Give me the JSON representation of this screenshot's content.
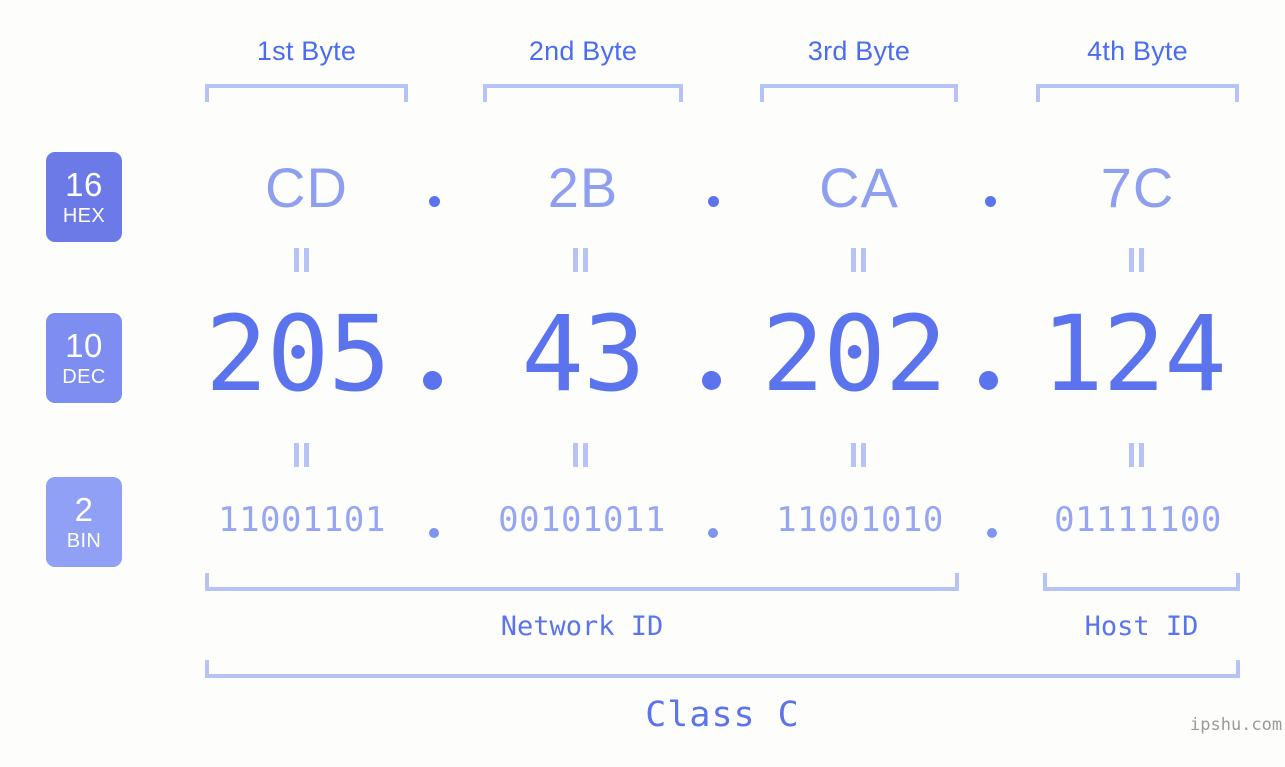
{
  "background_color": "#fdfefb",
  "colors": {
    "label_blue": "#4a6cf0",
    "bracket": "#b7c3f7",
    "hex_text": "#8f9ff0",
    "dec_text": "#5b74ee",
    "bin_text": "#97a6f2",
    "badge_hex": "#6c7ae8",
    "badge_dec": "#7d8df0",
    "badge_bin": "#8fa0f5",
    "watermark": "#9a9a9a"
  },
  "byte_headers": [
    {
      "label": "1st Byte"
    },
    {
      "label": "2nd Byte"
    },
    {
      "label": "3rd Byte"
    },
    {
      "label": "4th Byte"
    }
  ],
  "badges": [
    {
      "radix": "16",
      "name": "HEX"
    },
    {
      "radix": "10",
      "name": "DEC"
    },
    {
      "radix": "2",
      "name": "BIN"
    }
  ],
  "rows": {
    "hex": {
      "values": [
        "CD",
        "2B",
        "CA",
        "7C"
      ],
      "separator": "."
    },
    "dec": {
      "values": [
        "205",
        "43",
        "202",
        "124"
      ],
      "separator": "."
    },
    "bin": {
      "values": [
        "11001101",
        "00101011",
        "11001010",
        "01111100"
      ],
      "separator": "."
    }
  },
  "equals_symbol": "=",
  "footer": {
    "network_id": "Network ID",
    "host_id": "Host ID",
    "class": "Class C"
  },
  "watermark": "ipshu.com",
  "ip_address": "205.43.202.124"
}
